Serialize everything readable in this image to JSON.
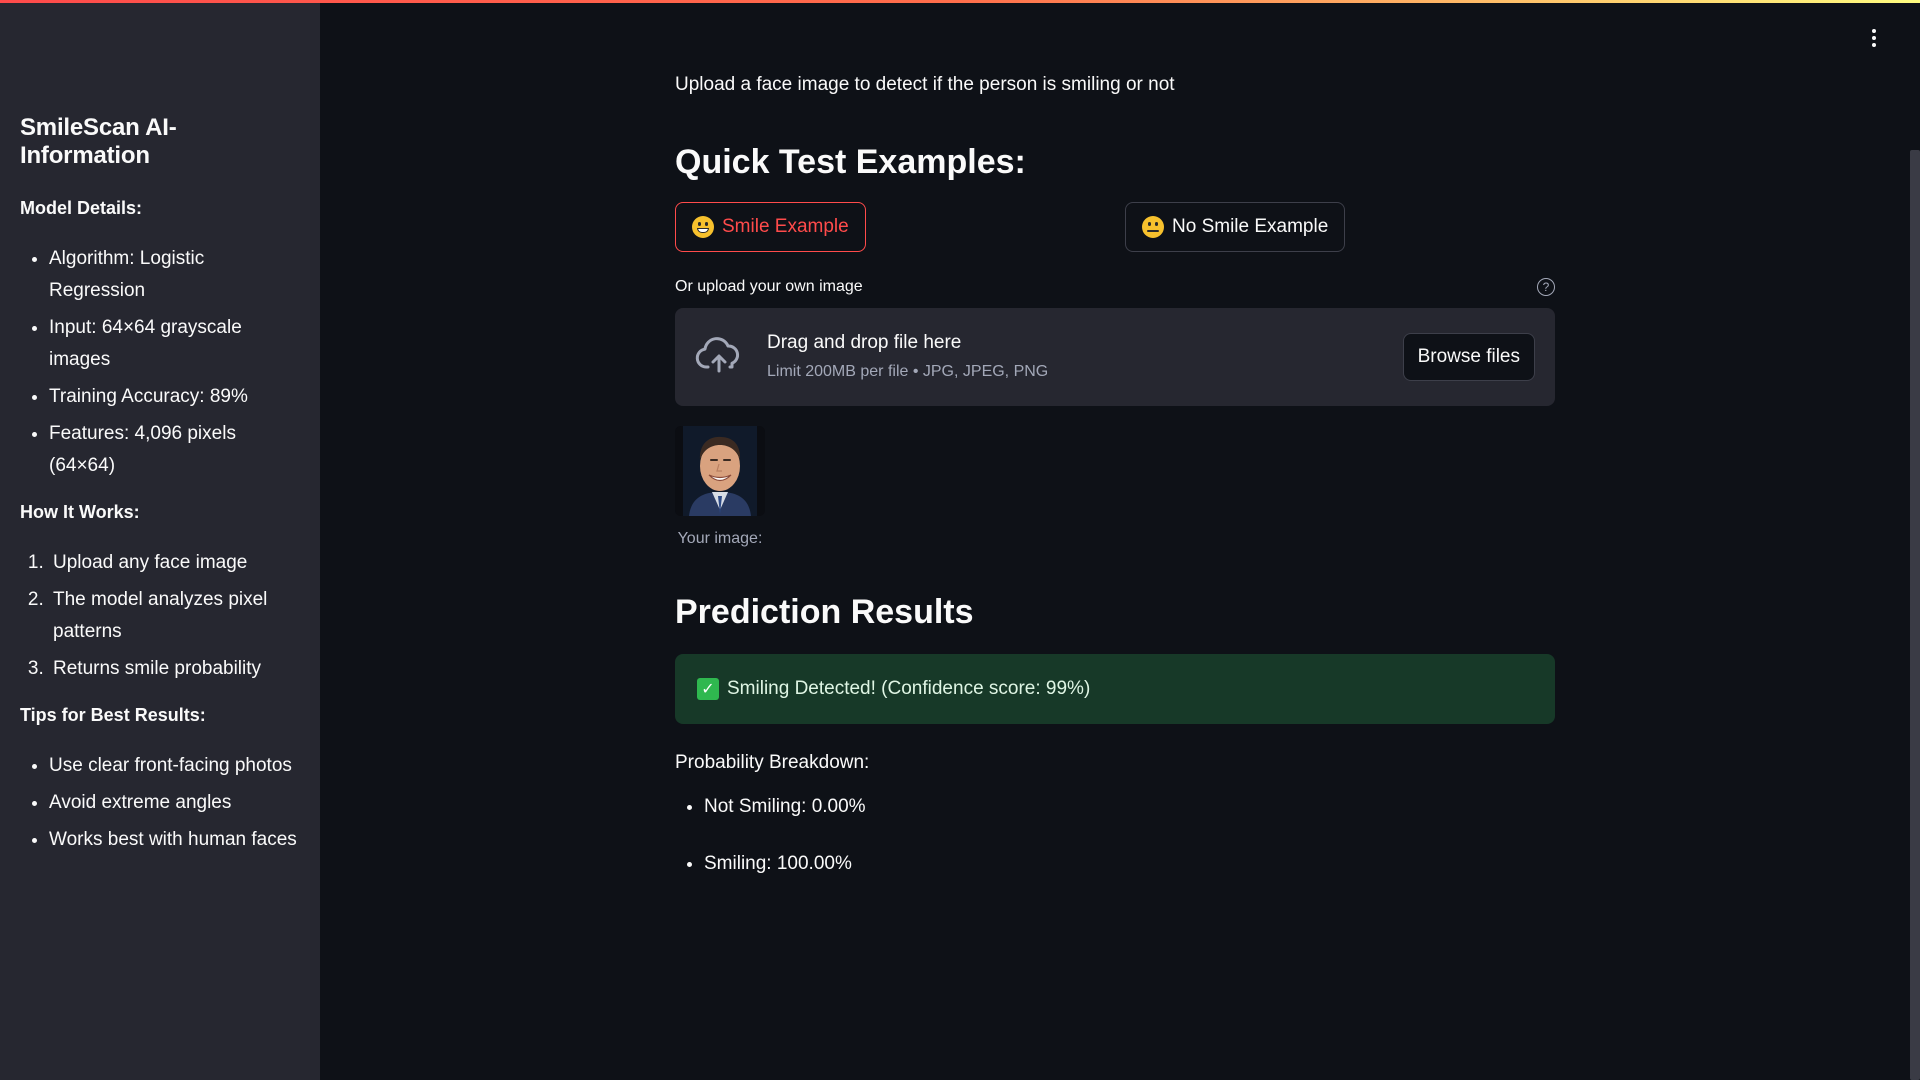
{
  "sidebar": {
    "title": "SmileScan AI-Information",
    "model_heading": "Model Details:",
    "model_items": [
      "Algorithm: Logistic Regression",
      "Input: 64×64 grayscale images",
      "Training Accuracy: 89%",
      "Features: 4,096 pixels (64×64)"
    ],
    "how_heading": "How It Works:",
    "how_items": [
      "Upload any face image",
      "The model analyzes pixel patterns",
      "Returns smile probability"
    ],
    "tips_heading": "Tips for Best Results:",
    "tips_items": [
      "Use clear front-facing photos",
      "Avoid extreme angles",
      "Works best with human faces"
    ]
  },
  "main": {
    "subtitle": "Upload a face image to detect if the person is smiling or not",
    "examples_heading": "Quick Test Examples:",
    "smile_button": "Smile Example",
    "no_smile_button": "No Smile Example",
    "uploader_label": "Or upload your own image",
    "dropzone_title": "Drag and drop file here",
    "dropzone_limit": "Limit 200MB per file • JPG, JPEG, PNG",
    "browse_button": "Browse files",
    "image_caption": "Your image:",
    "results_heading": "Prediction Results",
    "result_alert": "Smiling Detected! (Confidence score: 99%)",
    "breakdown_title": "Probability Breakdown:",
    "breakdown_items": [
      "Not Smiling: 0.00%",
      "Smiling: 100.00%"
    ]
  },
  "colors": {
    "background": "#0e1117",
    "sidebar": "#262730",
    "accent": "#ff4b4b",
    "success_bg": "#173928"
  },
  "icons": {
    "menu": "more-vertical-icon",
    "help": "question-circle-icon",
    "upload": "cloud-upload-icon",
    "smile_emoji": "grinning-face-icon",
    "neutral_emoji": "neutral-face-icon",
    "success": "check-mark-icon"
  }
}
